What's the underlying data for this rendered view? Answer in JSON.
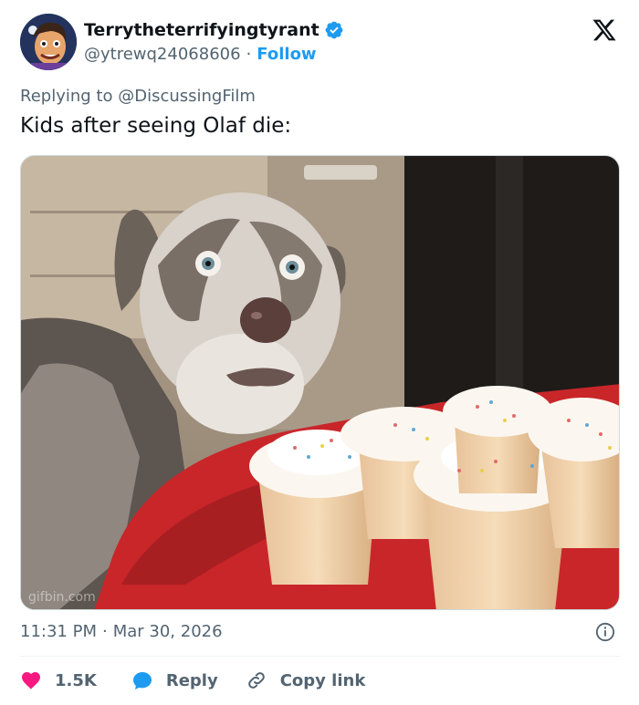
{
  "author": {
    "display_name": "Terrytheterrifyingtyrant",
    "handle": "@ytrewq24068606",
    "separator": "·",
    "follow_label": "Follow"
  },
  "tweet": {
    "replying_prefix": "Replying to ",
    "replying_to": "@DiscussingFilm",
    "text": "Kids after seeing Olaf die:",
    "time": "11:31 PM",
    "date_separator": "·",
    "date": "Mar 30, 2026",
    "media_watermark": "gifbin.com"
  },
  "actions": {
    "like_count": "1.5K",
    "reply_label": "Reply",
    "copy_link_label": "Copy link"
  },
  "colors": {
    "accent": "#1d9bf0",
    "like": "#f91880",
    "text": "#0f1419",
    "muted": "#536471"
  },
  "icons": [
    "verified-badge-icon",
    "x-logo-icon",
    "info-icon",
    "heart-icon",
    "reply-bubble-icon",
    "link-icon"
  ]
}
